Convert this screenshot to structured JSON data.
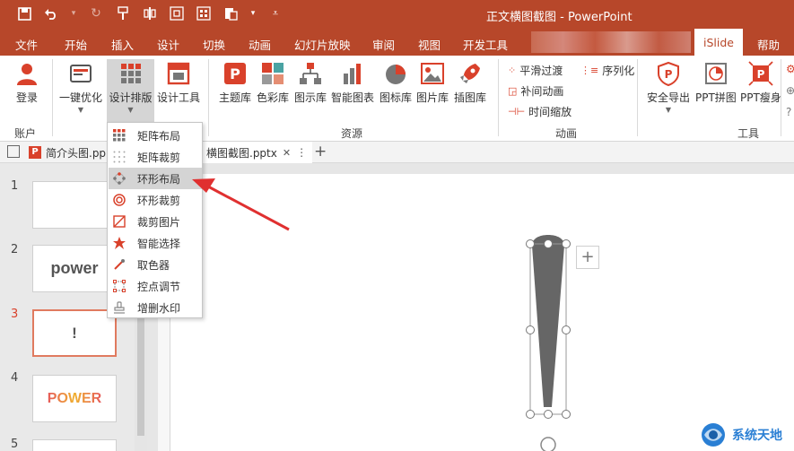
{
  "window": {
    "title": "正文横图截图 - PowerPoint"
  },
  "tabs": [
    "文件",
    "开始",
    "插入",
    "设计",
    "切换",
    "动画",
    "幻灯片放映",
    "审阅",
    "视图",
    "开发工具",
    "iSlide",
    "帮助"
  ],
  "ribbon": {
    "account": {
      "login": "登录",
      "group": "账户"
    },
    "design": {
      "optimize": "一键优化",
      "layout": "设计排版",
      "tools": "设计工具"
    },
    "resources": {
      "theme": "主题库",
      "color": "色彩库",
      "diagram": "图示库",
      "smart_chart": "智能图表",
      "icon": "图标库",
      "image": "图片库",
      "illustration": "插图库",
      "group": "资源"
    },
    "animation": {
      "smooth": "平滑过渡",
      "serialize": "序列化",
      "tween": "补间动画",
      "time_scale": "时间缩放",
      "group": "动画"
    },
    "tools": {
      "safe_export": "安全导出",
      "ppt_collage": "PPT拼图",
      "ppt_slim": "PPT瘦身",
      "group": "工具"
    }
  },
  "doc_tabs": {
    "tab1": "简介头图.pp",
    "tab2": "横图截图.pptx",
    "close": "✕",
    "more": "⋮",
    "add": "+"
  },
  "menu": {
    "items": [
      "矩阵布局",
      "矩阵裁剪",
      "环形布局",
      "环形裁剪",
      "裁剪图片",
      "智能选择",
      "取色器",
      "控点调节",
      "增删水印"
    ],
    "highlighted": "环形布局"
  },
  "slides": [
    {
      "num": "1",
      "text": ""
    },
    {
      "num": "2",
      "text": "power"
    },
    {
      "num": "3",
      "text": "!"
    },
    {
      "num": "4",
      "text": "POWER"
    },
    {
      "num": "5",
      "text": ""
    }
  ],
  "canvas": {
    "plus": "+"
  },
  "watermark": {
    "text": "系统天地"
  },
  "colors": {
    "accent": "#b7472a",
    "menu_highlight": "#d4d4d4",
    "arrow": "#e03030",
    "shape": "#666666"
  }
}
